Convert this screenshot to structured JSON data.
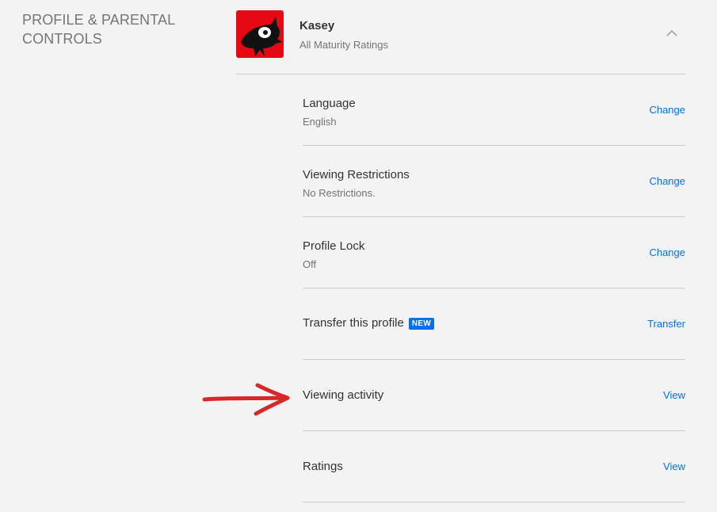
{
  "section": {
    "title": "PROFILE & PARENTAL CONTROLS"
  },
  "profile": {
    "name": "Kasey",
    "maturity": "All Maturity Ratings"
  },
  "settings": [
    {
      "title": "Language",
      "value": "English",
      "action": "Change"
    },
    {
      "title": "Viewing Restrictions",
      "value": "No Restrictions.",
      "action": "Change"
    },
    {
      "title": "Profile Lock",
      "value": "Off",
      "action": "Change"
    },
    {
      "title": "Transfer this profile",
      "badge": "NEW",
      "action": "Transfer"
    },
    {
      "title": "Viewing activity",
      "action": "View"
    },
    {
      "title": "Ratings",
      "action": "View"
    }
  ],
  "colors": {
    "link": "#0073e6",
    "badge": "#0071eb",
    "arrow": "#d62828",
    "avatar_bg": "#e50914"
  },
  "icons": {
    "collapse": "chevron-up-icon",
    "annotation": "red-arrow-icon"
  }
}
